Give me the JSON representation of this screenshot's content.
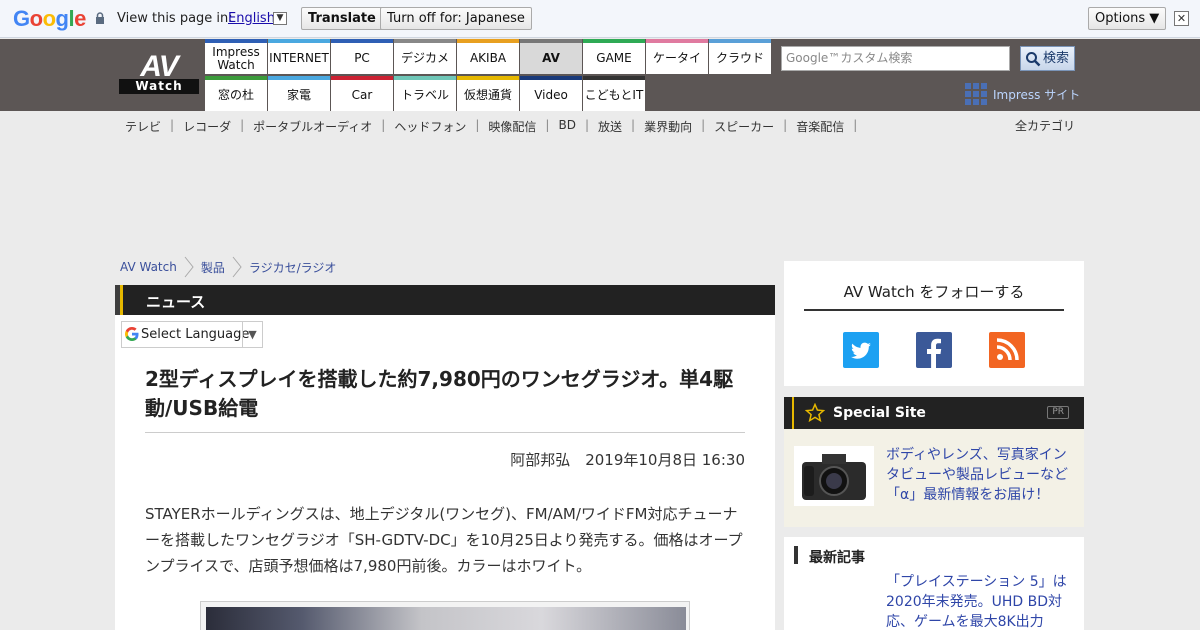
{
  "translate_bar": {
    "logo": "Google",
    "view_text": "View this page in:",
    "language": "English",
    "translate_label": "Translate",
    "turn_off_label": "Turn off for: Japanese",
    "options_label": "Options ▼",
    "close_label": "✕"
  },
  "header": {
    "logo_top": "AV",
    "logo_bottom": "Watch",
    "nav_top": [
      "Impress Watch",
      "INTERNET",
      "PC",
      "デジカメ",
      "AKIBA",
      "AV",
      "GAME",
      "ケータイ",
      "クラウド"
    ],
    "nav_bottom": [
      "窓の杜",
      "家電",
      "Car",
      "トラベル",
      "仮想通貨",
      "Video",
      "こどもとIT"
    ],
    "search_placeholder": "Google™カスタム検索",
    "search_button": "検索",
    "impress_site": "Impress サイト"
  },
  "colors": {
    "nav_top": [
      "#2e5fb5",
      "#4aa8e0",
      "#2e5fb5",
      "#888888",
      "#e8a020",
      "#777777",
      "#2eaa55",
      "#e07aa0",
      "#5aa0d8"
    ],
    "nav_bottom": [
      "#3b9b3b",
      "#4aa8e0",
      "#cc2233",
      "#6fc7b8",
      "#e6b800",
      "#1a3a7a",
      "#333333"
    ]
  },
  "categories": [
    "テレビ",
    "レコーダ",
    "ポータブルオーディオ",
    "ヘッドフォン",
    "映像配信",
    "BD",
    "放送",
    "業界動向",
    "スピーカー",
    "音楽配信"
  ],
  "all_categories": "全カテゴリ",
  "breadcrumb": [
    "AV Watch",
    "製品",
    "ラジカセ/ラジオ"
  ],
  "main": {
    "section": "ニュース",
    "select_language": "Select Language",
    "title": "2型ディスプレイを搭載した約7,980円のワンセグラジオ。単4駆動/USB給電",
    "byline": "阿部邦弘　2019年10月8日 16:30",
    "body": "STAYERホールディングスは、地上デジタル(ワンセグ)、FM/AM/ワイドFM対応チューナーを搭載したワンセグラジオ「SH-GDTV-DC」を10月25日より発売する。価格はオープンプライスで、店頭予想価格は7,980円前後。カラーはホワイト。"
  },
  "sidebar": {
    "follow_title": "AV Watch をフォローする",
    "special_title": "Special Site",
    "special_pr": "PR",
    "special_text": "ボディやレンズ、写真家インタビューや製品レビューなど「α」最新情報をお届け！",
    "latest_title": "最新記事",
    "latest_item": "「プレイステーション 5」は2020年末発売。UHD BD対応、ゲームを最大8K出力"
  }
}
